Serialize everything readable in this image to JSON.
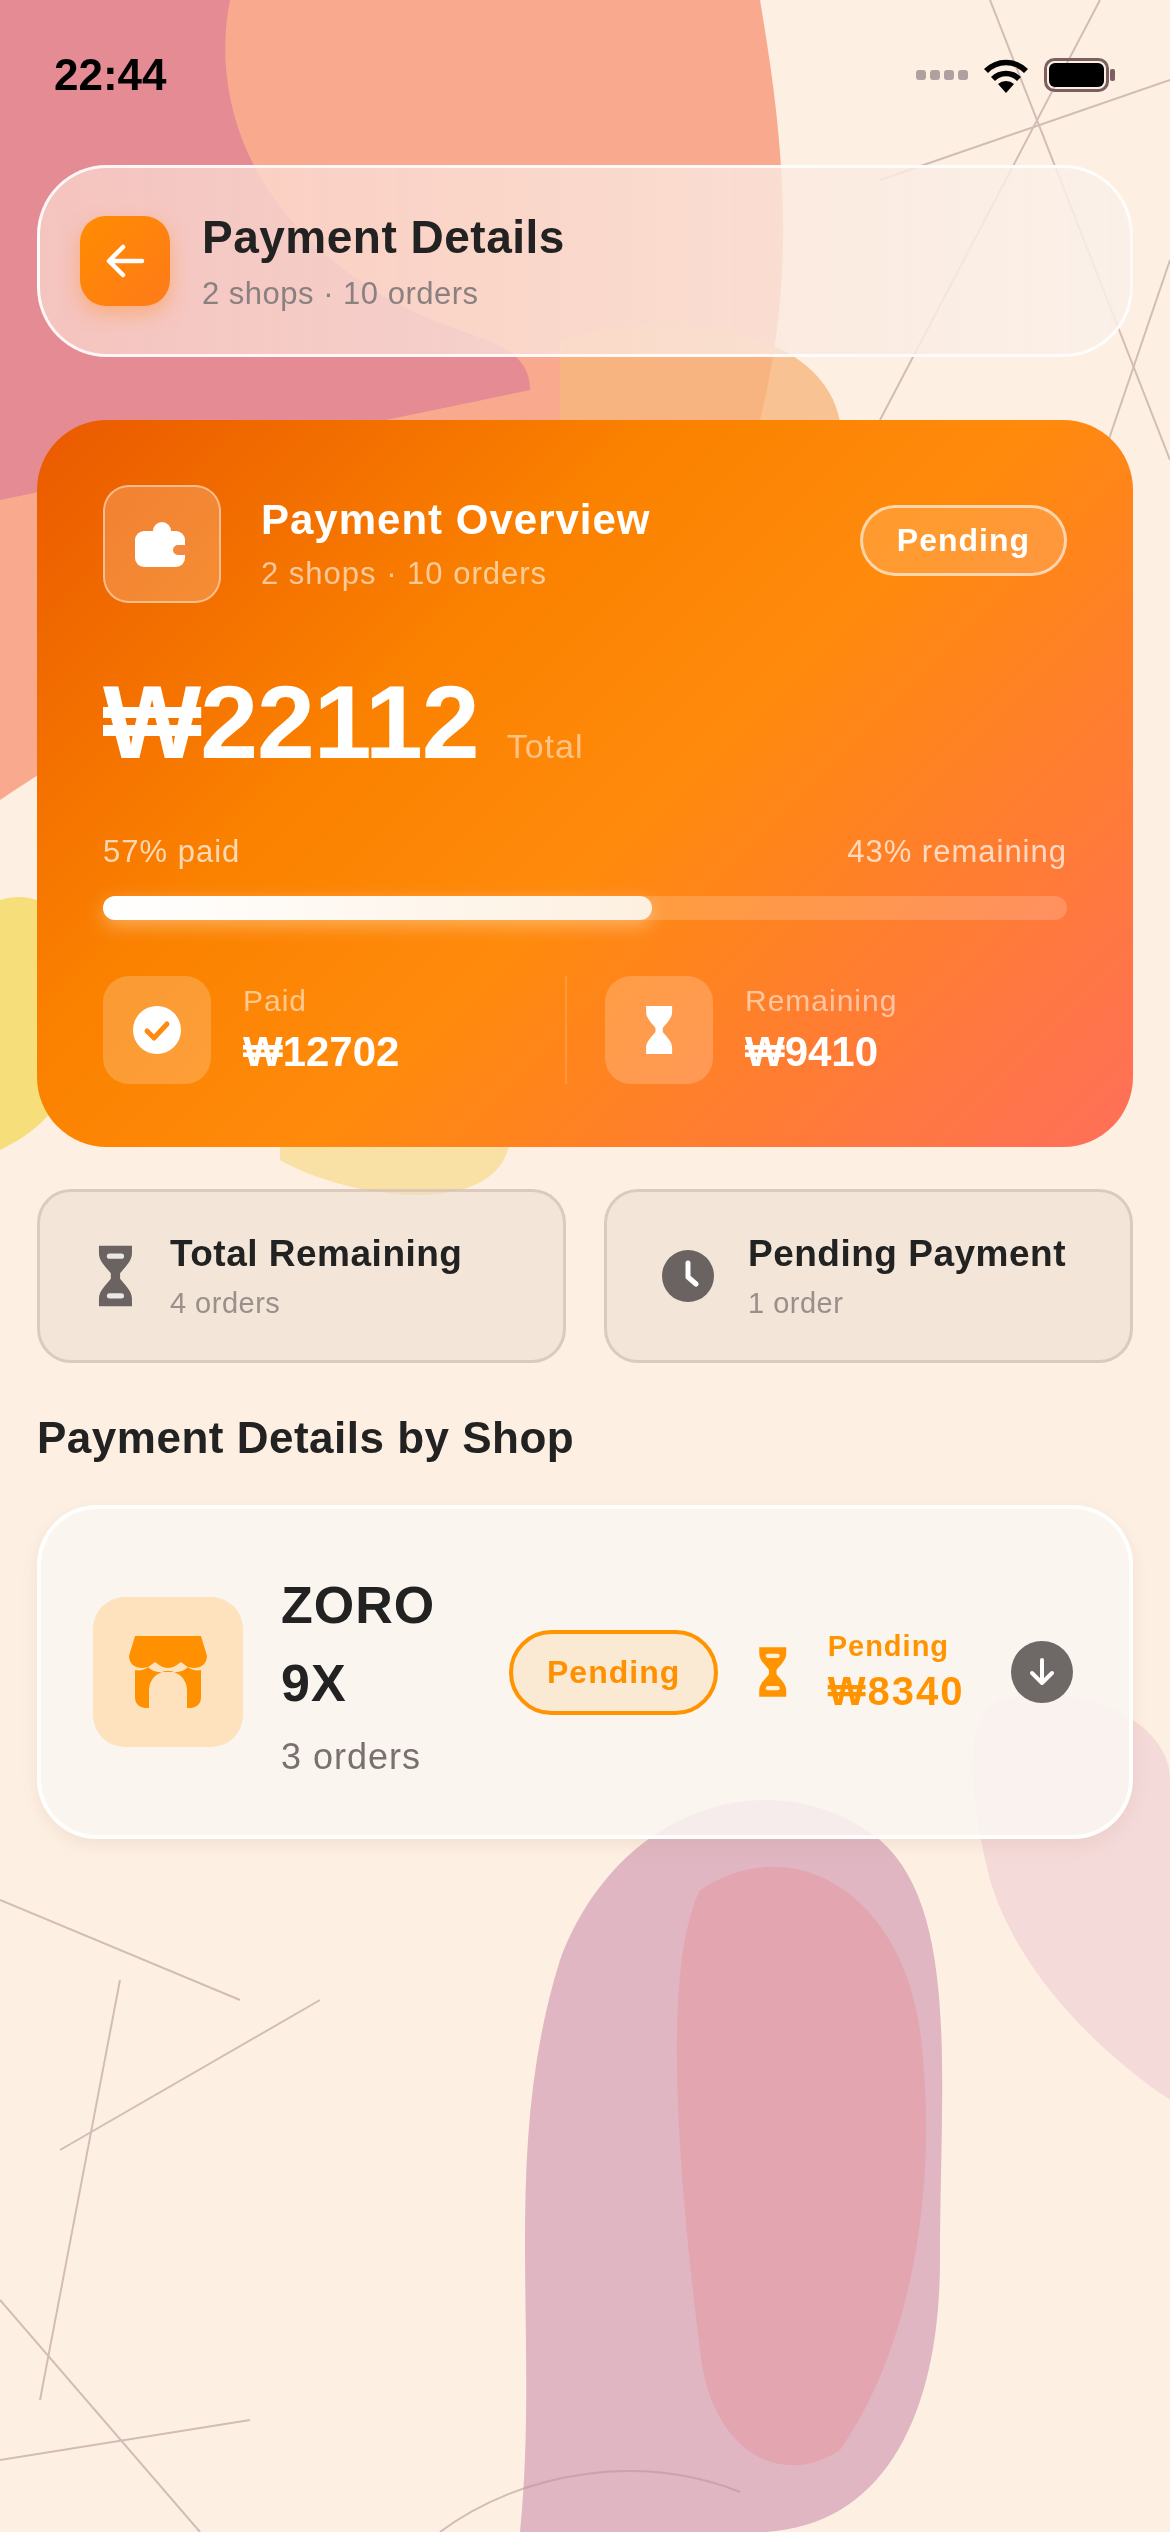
{
  "status_bar": {
    "time": "22:44"
  },
  "header": {
    "title": "Payment Details",
    "subtitle": "2 shops · 10 orders"
  },
  "overview": {
    "title": "Payment Overview",
    "subtitle": "2 shops · 10 orders",
    "badge": "Pending",
    "total": "₩22112",
    "total_label": "Total",
    "paid_label": "57% paid",
    "remaining_label": "43% remaining",
    "level": 0.57,
    "stats": [
      {
        "kind": "paid",
        "label": "Paid",
        "value": "₩12702"
      },
      {
        "kind": "remaining",
        "label": "Remaining",
        "value": "₩9410"
      }
    ]
  },
  "summary_tiles": [
    {
      "kind": "hourglass",
      "title": "Total Remaining",
      "subtitle": "4 orders"
    },
    {
      "kind": "clock",
      "title": "Pending Payment",
      "subtitle": "1 order"
    }
  ],
  "section_title": "Payment Details by Shop",
  "shops": [
    {
      "name": "ZORO 9X",
      "orders": "3 orders",
      "status": "Pending",
      "amount_label": "Pending",
      "amount": "₩8340"
    }
  ]
}
